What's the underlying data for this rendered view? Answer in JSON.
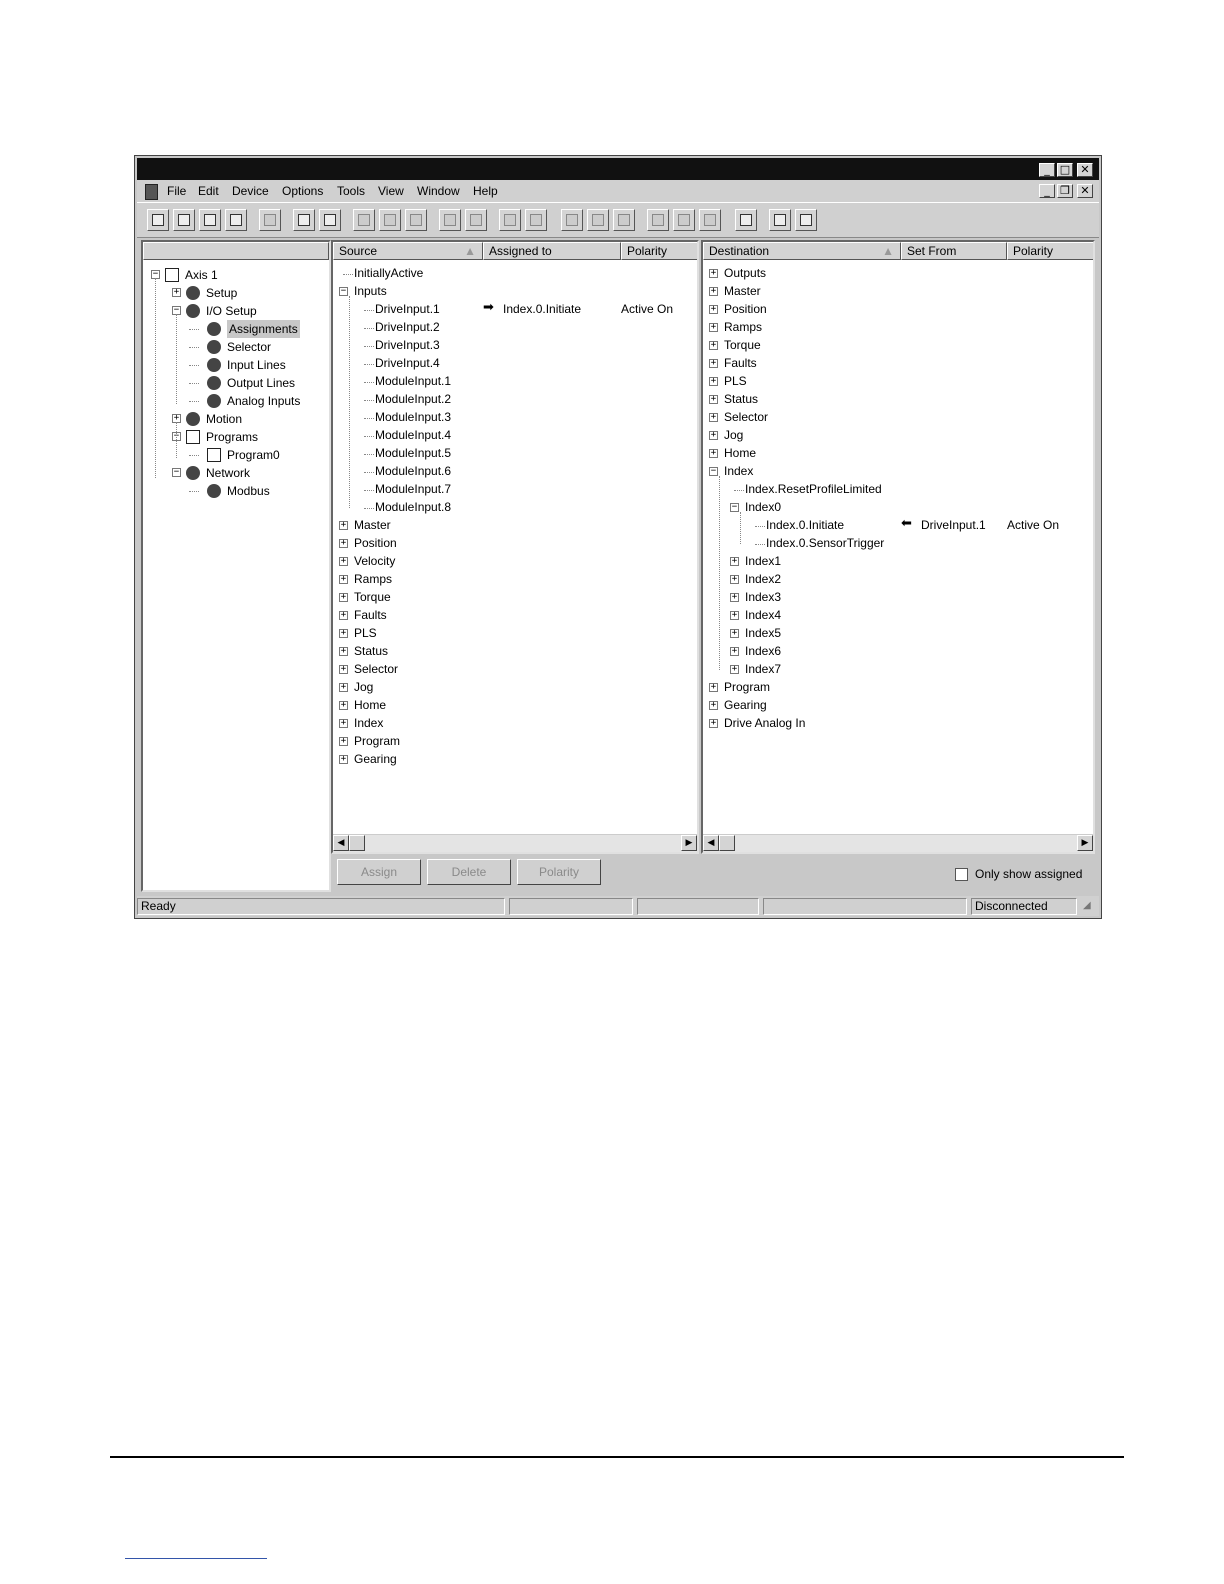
{
  "window": {
    "caption_buttons": [
      "_",
      "□",
      "✕"
    ],
    "mdi_buttons": [
      "_",
      "❐",
      "✕"
    ]
  },
  "menu": [
    "File",
    "Edit",
    "Device",
    "Options",
    "Tools",
    "View",
    "Window",
    "Help"
  ],
  "left_tree": [
    {
      "label": "Axis 1",
      "level": 0,
      "expander": "−",
      "icon": "drive-icon"
    },
    {
      "label": "Setup",
      "level": 1,
      "expander": "+",
      "icon": "setup-icon"
    },
    {
      "label": "I/O Setup",
      "level": 1,
      "expander": "−",
      "icon": "io-icon"
    },
    {
      "label": "Assignments",
      "level": 2,
      "expander": "",
      "icon": "assignments-icon",
      "selected": true
    },
    {
      "label": "Selector",
      "level": 2,
      "expander": "",
      "icon": "selector-icon"
    },
    {
      "label": "Input Lines",
      "level": 2,
      "expander": "",
      "icon": "input-lines-icon"
    },
    {
      "label": "Output Lines",
      "level": 2,
      "expander": "",
      "icon": "output-lines-icon"
    },
    {
      "label": "Analog Inputs",
      "level": 2,
      "expander": "",
      "icon": "analog-inputs-icon"
    },
    {
      "label": "Motion",
      "level": 1,
      "expander": "+",
      "icon": "motion-icon"
    },
    {
      "label": "Programs",
      "level": 1,
      "expander": "−",
      "icon": "programs-icon"
    },
    {
      "label": "Program0",
      "level": 2,
      "expander": "",
      "icon": "program-icon"
    },
    {
      "label": "Network",
      "level": 1,
      "expander": "−",
      "icon": "network-icon"
    },
    {
      "label": "Modbus",
      "level": 2,
      "expander": "",
      "icon": "modbus-icon"
    }
  ],
  "source_pane": {
    "columns": [
      "Source",
      "Assigned to",
      "Polarity"
    ],
    "rows": [
      {
        "label": "InitiallyActive",
        "level": 0,
        "expander": ""
      },
      {
        "label": "Inputs",
        "level": 0,
        "expander": "−"
      },
      {
        "label": "DriveInput.1",
        "level": 1,
        "expander": "",
        "assigned": "Index.0.Initiate",
        "polarity": "Active On"
      },
      {
        "label": "DriveInput.2",
        "level": 1,
        "expander": ""
      },
      {
        "label": "DriveInput.3",
        "level": 1,
        "expander": ""
      },
      {
        "label": "DriveInput.4",
        "level": 1,
        "expander": ""
      },
      {
        "label": "ModuleInput.1",
        "level": 1,
        "expander": ""
      },
      {
        "label": "ModuleInput.2",
        "level": 1,
        "expander": ""
      },
      {
        "label": "ModuleInput.3",
        "level": 1,
        "expander": ""
      },
      {
        "label": "ModuleInput.4",
        "level": 1,
        "expander": ""
      },
      {
        "label": "ModuleInput.5",
        "level": 1,
        "expander": ""
      },
      {
        "label": "ModuleInput.6",
        "level": 1,
        "expander": ""
      },
      {
        "label": "ModuleInput.7",
        "level": 1,
        "expander": ""
      },
      {
        "label": "ModuleInput.8",
        "level": 1,
        "expander": ""
      },
      {
        "label": "Master",
        "level": 0,
        "expander": "+"
      },
      {
        "label": "Position",
        "level": 0,
        "expander": "+"
      },
      {
        "label": "Velocity",
        "level": 0,
        "expander": "+"
      },
      {
        "label": "Ramps",
        "level": 0,
        "expander": "+"
      },
      {
        "label": "Torque",
        "level": 0,
        "expander": "+"
      },
      {
        "label": "Faults",
        "level": 0,
        "expander": "+"
      },
      {
        "label": "PLS",
        "level": 0,
        "expander": "+"
      },
      {
        "label": "Status",
        "level": 0,
        "expander": "+"
      },
      {
        "label": "Selector",
        "level": 0,
        "expander": "+"
      },
      {
        "label": "Jog",
        "level": 0,
        "expander": "+"
      },
      {
        "label": "Home",
        "level": 0,
        "expander": "+"
      },
      {
        "label": "Index",
        "level": 0,
        "expander": "+"
      },
      {
        "label": "Program",
        "level": 0,
        "expander": "+"
      },
      {
        "label": "Gearing",
        "level": 0,
        "expander": "+"
      }
    ]
  },
  "destination_pane": {
    "columns": [
      "Destination",
      "Set From",
      "Polarity"
    ],
    "rows": [
      {
        "label": "Outputs",
        "level": 0,
        "expander": "+"
      },
      {
        "label": "Master",
        "level": 0,
        "expander": "+"
      },
      {
        "label": "Position",
        "level": 0,
        "expander": "+"
      },
      {
        "label": "Ramps",
        "level": 0,
        "expander": "+"
      },
      {
        "label": "Torque",
        "level": 0,
        "expander": "+"
      },
      {
        "label": "Faults",
        "level": 0,
        "expander": "+"
      },
      {
        "label": "PLS",
        "level": 0,
        "expander": "+"
      },
      {
        "label": "Status",
        "level": 0,
        "expander": "+"
      },
      {
        "label": "Selector",
        "level": 0,
        "expander": "+"
      },
      {
        "label": "Jog",
        "level": 0,
        "expander": "+"
      },
      {
        "label": "Home",
        "level": 0,
        "expander": "+"
      },
      {
        "label": "Index",
        "level": 0,
        "expander": "−"
      },
      {
        "label": "Index.ResetProfileLimited",
        "level": 1,
        "expander": ""
      },
      {
        "label": "Index0",
        "level": 1,
        "expander": "−"
      },
      {
        "label": "Index.0.Initiate",
        "level": 2,
        "expander": "",
        "assigned": "DriveInput.1",
        "polarity": "Active On"
      },
      {
        "label": "Index.0.SensorTrigger",
        "level": 2,
        "expander": ""
      },
      {
        "label": "Index1",
        "level": 1,
        "expander": "+"
      },
      {
        "label": "Index2",
        "level": 1,
        "expander": "+"
      },
      {
        "label": "Index3",
        "level": 1,
        "expander": "+"
      },
      {
        "label": "Index4",
        "level": 1,
        "expander": "+"
      },
      {
        "label": "Index5",
        "level": 1,
        "expander": "+"
      },
      {
        "label": "Index6",
        "level": 1,
        "expander": "+"
      },
      {
        "label": "Index7",
        "level": 1,
        "expander": "+"
      },
      {
        "label": "Program",
        "level": 0,
        "expander": "+"
      },
      {
        "label": "Gearing",
        "level": 0,
        "expander": "+"
      },
      {
        "label": "Drive Analog In",
        "level": 0,
        "expander": "+"
      }
    ]
  },
  "buttons": {
    "assign": "Assign",
    "delete": "Delete",
    "polarity": "Polarity"
  },
  "only_show_assigned": {
    "label": "Only show assigned",
    "checked": false
  },
  "status_bar": {
    "left": "Ready",
    "right": "Disconnected"
  },
  "arrows": {
    "right": "➡",
    "left": "⬅"
  },
  "toolbar_icons": [
    "new-icon",
    "open-icon",
    "save-icon",
    "print-icon",
    "import-icon",
    "upload-icon",
    "download-icon",
    "insert-icon",
    "insert2-icon",
    "delete-icon",
    "add-icon",
    "remove-icon",
    "copy-icon",
    "paste-icon",
    "zoom-icon",
    "globe-icon",
    "link-icon",
    "device-icon",
    "stop-icon",
    "run-icon",
    "layout-icon",
    "help-icon",
    "context-help-icon"
  ]
}
